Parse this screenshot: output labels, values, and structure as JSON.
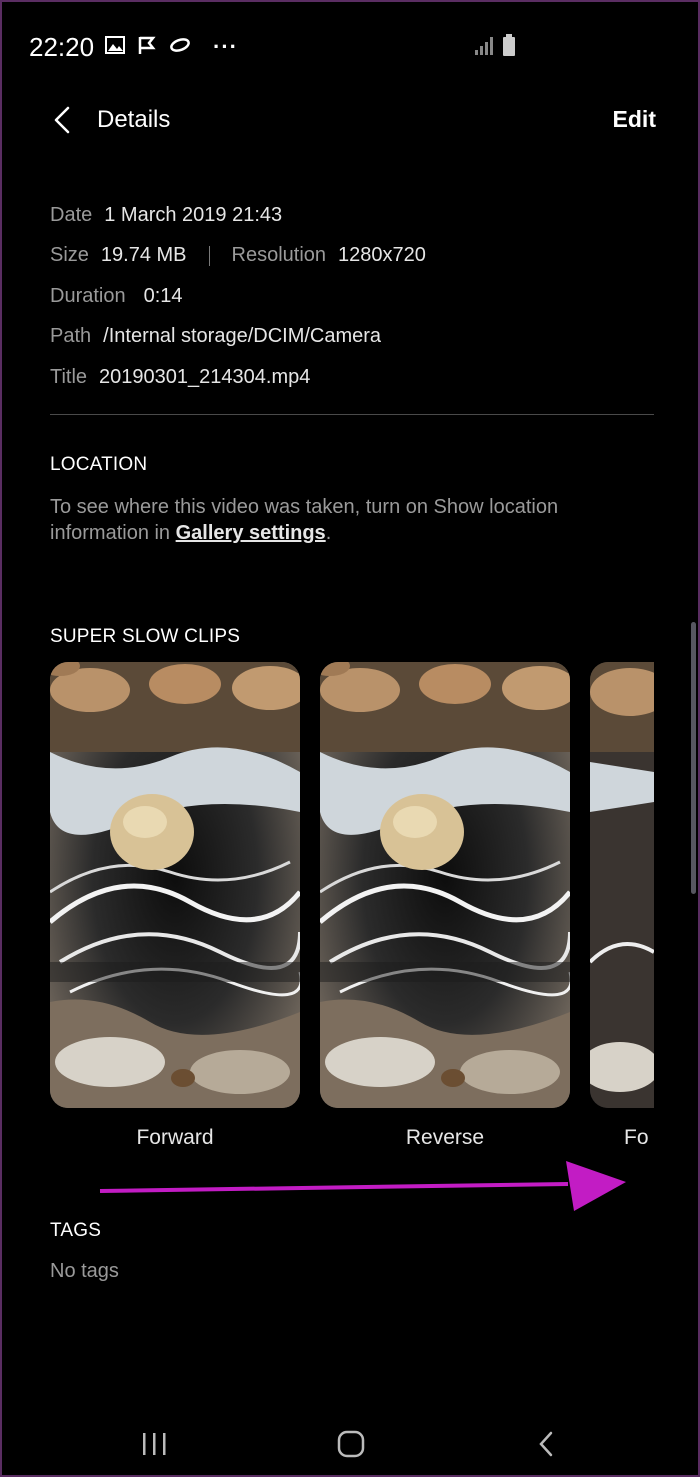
{
  "status_bar": {
    "time": "22:20",
    "more": "···",
    "icons": [
      "gallery-icon",
      "check-flag-icon",
      "link-icon",
      "signal-icon",
      "battery-icon"
    ]
  },
  "header": {
    "title": "Details",
    "edit_label": "Edit"
  },
  "details": {
    "date_label": "Date",
    "date_value": "1 March 2019 21:43",
    "size_label": "Size",
    "size_value": "19.74 MB",
    "resolution_label": "Resolution",
    "resolution_value": "1280x720",
    "duration_label": "Duration",
    "duration_value": "0:14",
    "path_label": "Path",
    "path_value": "/Internal storage/DCIM/Camera",
    "title_label": "Title",
    "title_value": "20190301_214304.mp4"
  },
  "location": {
    "heading": "LOCATION",
    "text_before": "To see where this video was taken, turn on Show location information in ",
    "link": "Gallery settings",
    "text_after": "."
  },
  "clips": {
    "heading": "SUPER SLOW CLIPS",
    "items": [
      {
        "label": "Forward"
      },
      {
        "label": "Reverse"
      },
      {
        "label": "Fo"
      }
    ]
  },
  "tags": {
    "heading": "TAGS",
    "value": "No tags"
  },
  "colors": {
    "background": "#000000",
    "annotation_arrow": "#c21cc4",
    "secondary_text": "#9a9a9a"
  }
}
